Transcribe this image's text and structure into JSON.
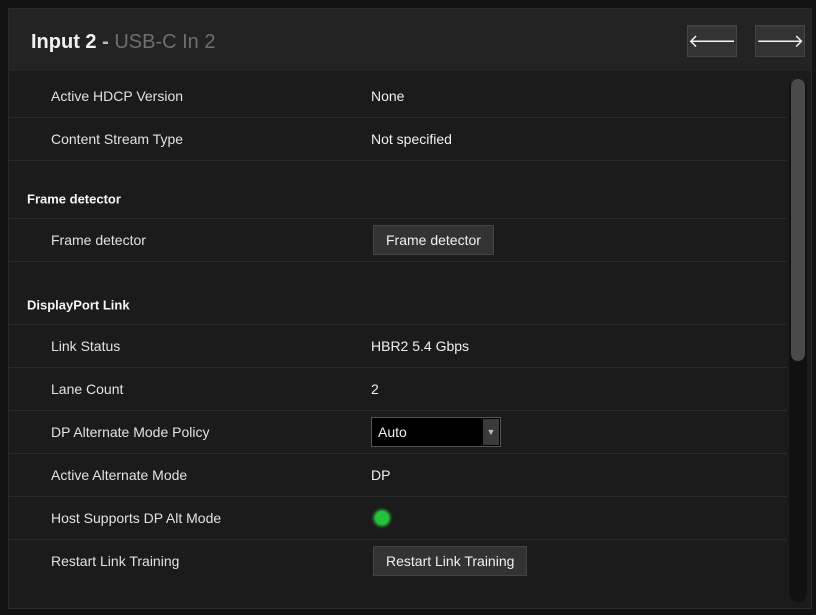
{
  "header": {
    "title": "Input 2",
    "separator": " - ",
    "subtitle": "USB-C In 2",
    "prev_icon": "arrow-left-icon",
    "next_icon": "arrow-right-icon",
    "prev_glyph": "🡐",
    "next_glyph": "🡒"
  },
  "hdcp": {
    "active_version_label": "Active HDCP Version",
    "active_version_value": "None",
    "content_stream_label": "Content Stream Type",
    "content_stream_value": "Not specified"
  },
  "frame_detector": {
    "section_title": "Frame detector",
    "label": "Frame detector",
    "button_label": "Frame detector"
  },
  "dp_link": {
    "section_title": "DisplayPort Link",
    "link_status_label": "Link Status",
    "link_status_value": "HBR2 5.4 Gbps",
    "lane_count_label": "Lane Count",
    "lane_count_value": "2",
    "alt_mode_policy_label": "DP Alternate Mode Policy",
    "alt_mode_policy_value": "Auto",
    "active_alt_mode_label": "Active Alternate Mode",
    "active_alt_mode_value": "DP",
    "host_supports_label": "Host Supports DP Alt Mode",
    "host_supports_status": "supported",
    "host_supports_color": "#27c23c",
    "restart_label": "Restart Link Training",
    "restart_button_label": "Restart Link Training"
  }
}
